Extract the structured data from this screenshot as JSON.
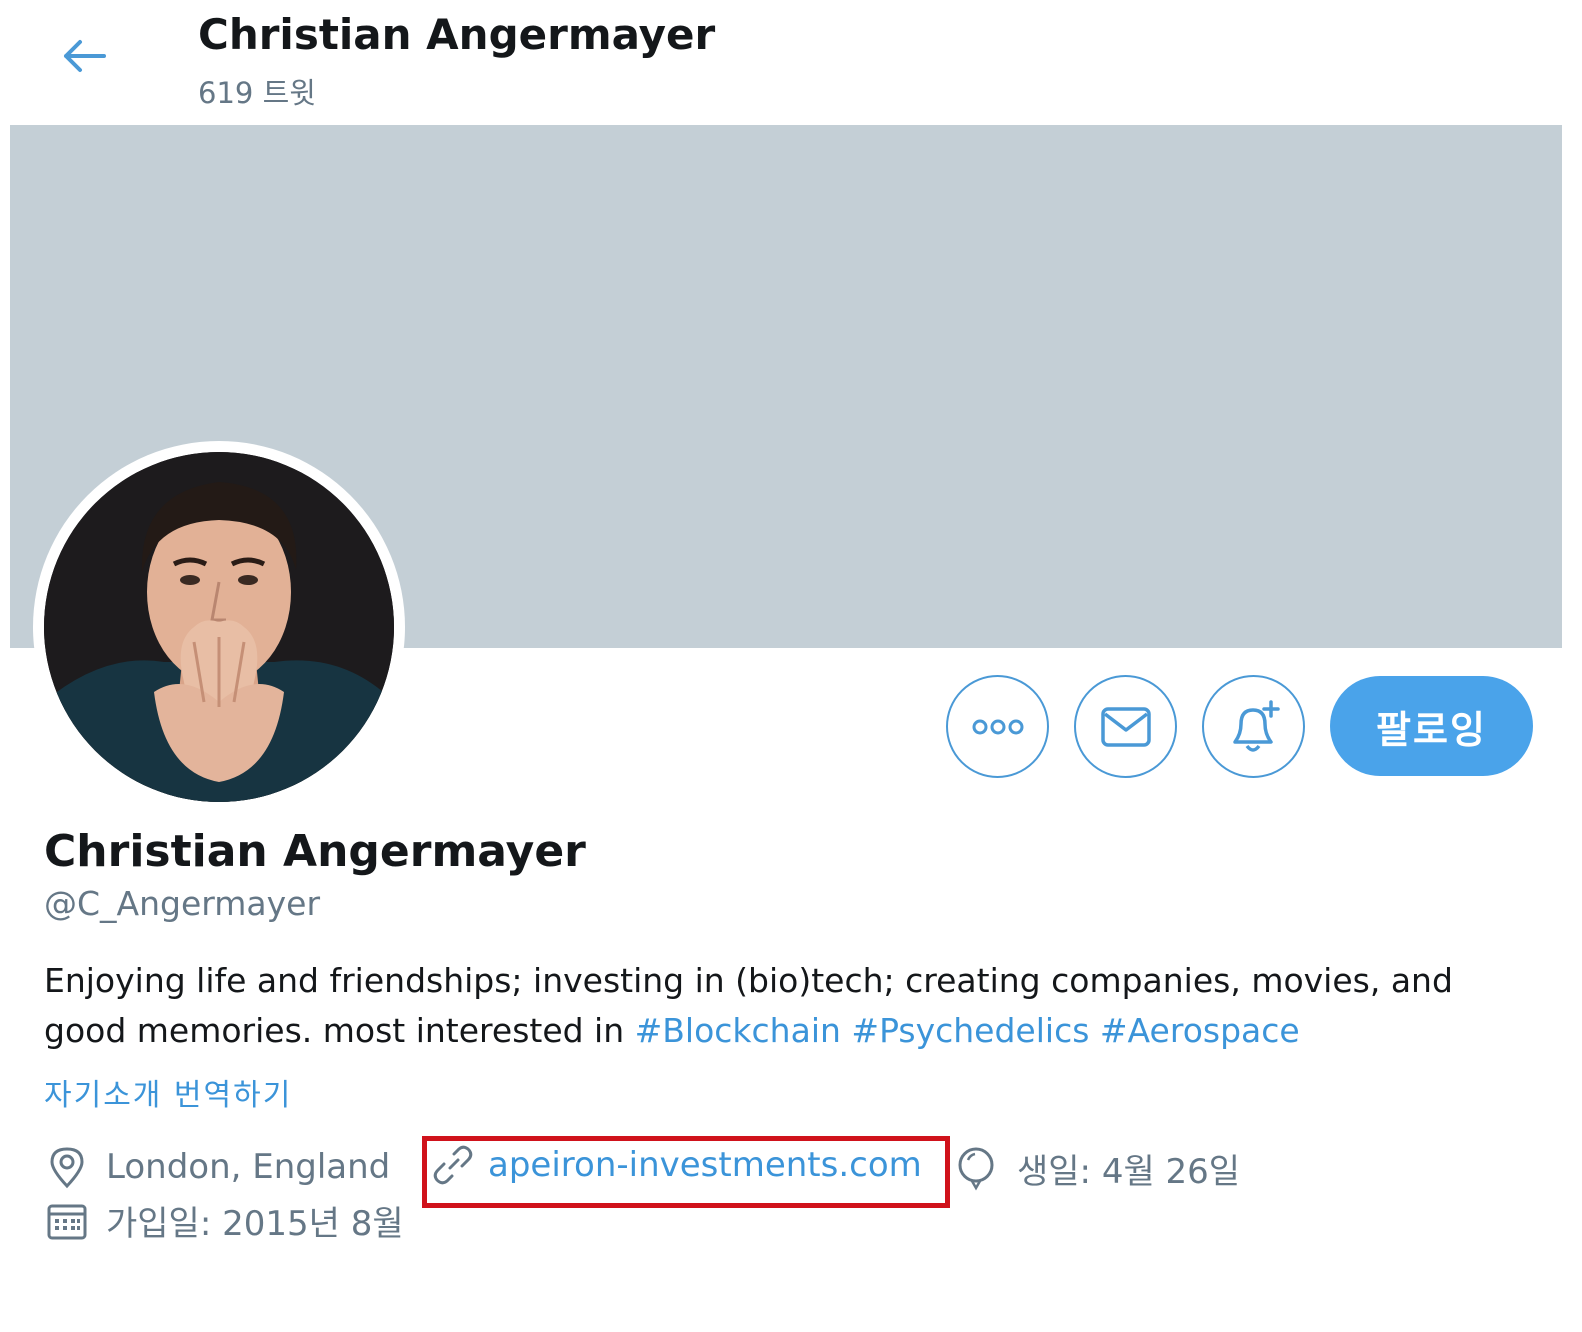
{
  "header": {
    "back_icon": "arrow-left-icon",
    "name": "Christian Angermayer",
    "tweet_count": "619 트윗"
  },
  "banner": {
    "color": "#c4cfd6"
  },
  "actions": {
    "more_icon": "more-dots-icon",
    "message_icon": "envelope-icon",
    "notify_icon": "bell-plus-icon",
    "follow_label": "팔로잉",
    "accent": "#4aa3ea"
  },
  "profile": {
    "name": "Christian Angermayer",
    "handle": "@C_Angermayer",
    "bio_text": "Enjoying life and friendships; investing in (bio)tech; creating companies, movies, and good memories. most interested in ",
    "hashtags": [
      "#Blockchain",
      "#Psychedelics",
      "#Aerospace"
    ],
    "translate_label": "자기소개 번역하기"
  },
  "meta": {
    "location": "London, England",
    "location_icon": "location-pin-icon",
    "website": "apeiron-investments.com",
    "website_icon": "link-icon",
    "birthday": "생일: 4월 26일",
    "birthday_icon": "balloon-icon",
    "joined": "가입일: 2015년 8월",
    "joined_icon": "calendar-icon"
  },
  "annotation": {
    "highlight_color": "#d0121b"
  }
}
